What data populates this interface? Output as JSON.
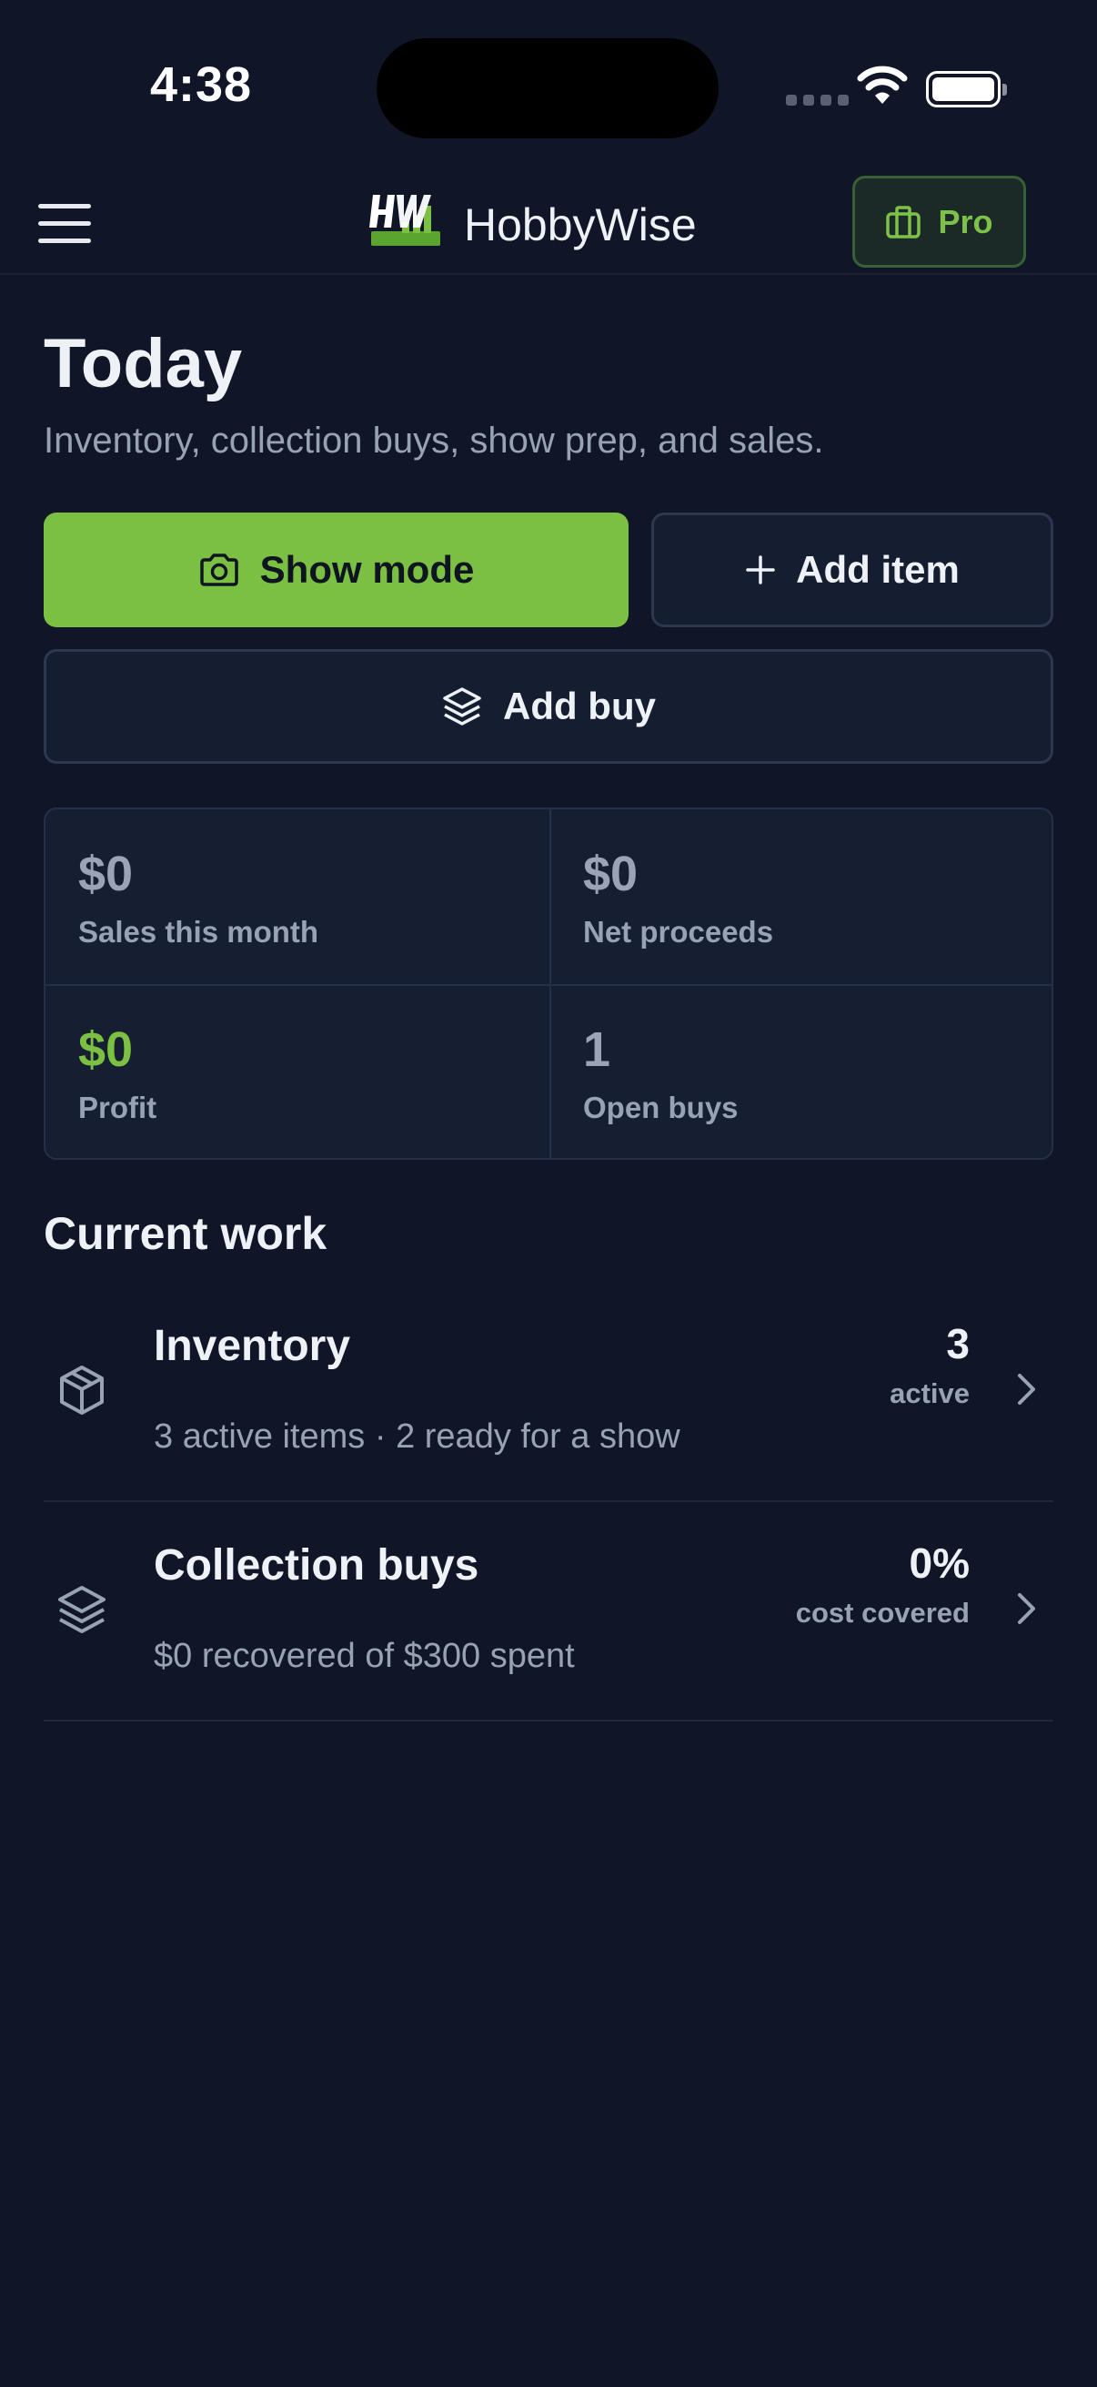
{
  "status_bar": {
    "time": "4:38"
  },
  "header": {
    "brand_name": "HobbyWise",
    "pro_label": "Pro"
  },
  "page": {
    "title": "Today",
    "subtitle": "Inventory, collection buys, show prep, and sales."
  },
  "actions": {
    "show_mode": "Show mode",
    "add_item": "Add item",
    "add_buy": "Add buy"
  },
  "stats": [
    {
      "value": "$0",
      "label": "Sales this month"
    },
    {
      "value": "$0",
      "label": "Net proceeds"
    },
    {
      "value": "$0",
      "label": "Profit"
    },
    {
      "value": "1",
      "label": "Open buys"
    }
  ],
  "colors": {
    "accent": "#7bc043",
    "background": "#101628"
  },
  "current_work": {
    "title": "Current work",
    "items": [
      {
        "icon": "box-icon",
        "title": "Inventory",
        "description": "3 active items · 2 ready for a show",
        "metric": "3",
        "metric_label": "active"
      },
      {
        "icon": "layers-icon",
        "title": "Collection buys",
        "description": "$0 recovered of $300 spent",
        "metric": "0%",
        "metric_label": "cost covered"
      }
    ]
  }
}
